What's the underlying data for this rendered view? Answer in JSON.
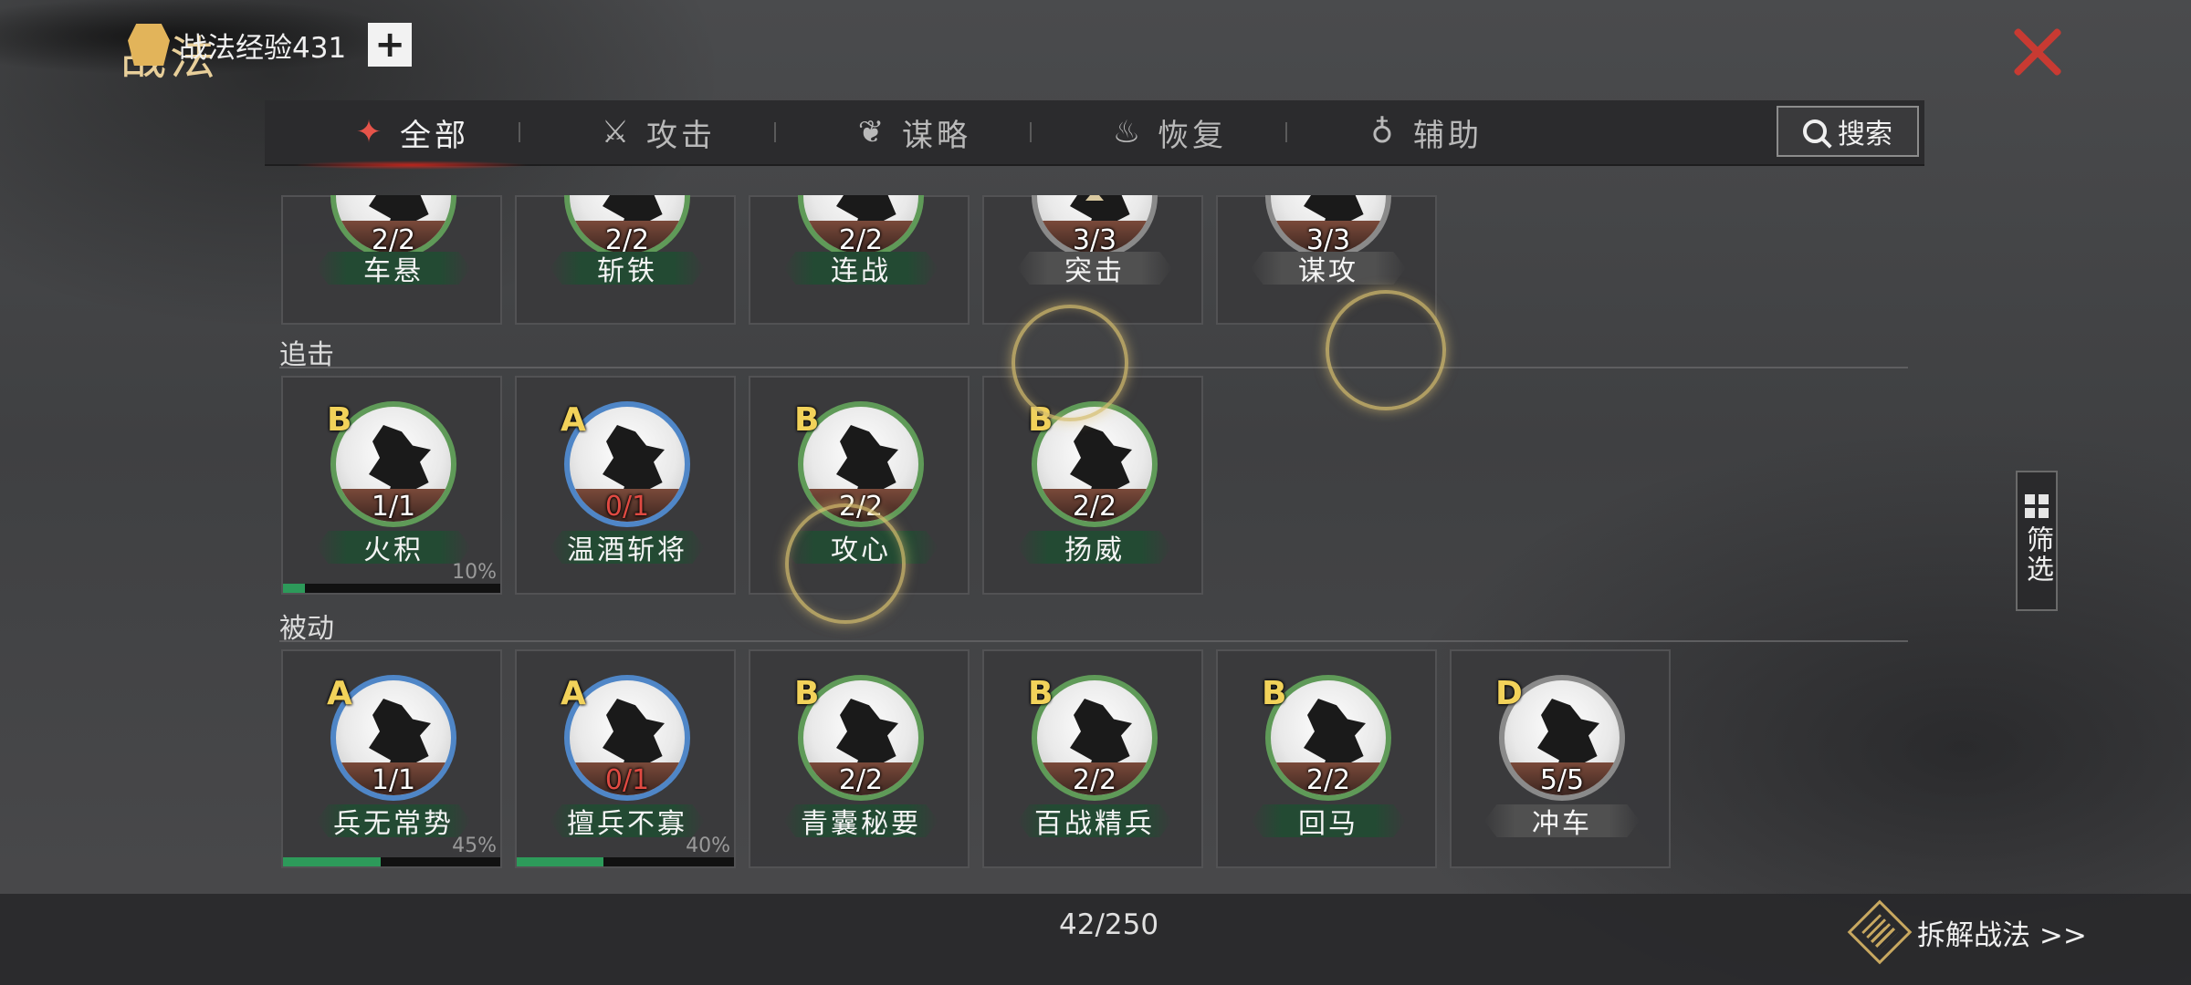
{
  "title": "战法",
  "tabs": [
    {
      "label": "全部",
      "icon": "scroll-icon",
      "active": true
    },
    {
      "label": "攻击",
      "icon": "crossed-swords-icon",
      "active": false
    },
    {
      "label": "谋略",
      "icon": "fan-icon",
      "active": false
    },
    {
      "label": "恢复",
      "icon": "teapot-icon",
      "active": false
    },
    {
      "label": "辅助",
      "icon": "pouch-icon",
      "active": false
    }
  ],
  "search_label": "搜索",
  "filter_label": "筛选",
  "top_row": [
    {
      "name": "车悬",
      "count": "2/2",
      "plate": "green"
    },
    {
      "name": "斩铁",
      "count": "2/2",
      "plate": "green"
    },
    {
      "name": "连战",
      "count": "2/2",
      "plate": "green"
    },
    {
      "name": "突击",
      "count": "3/3",
      "plate": "grey"
    },
    {
      "name": "谋攻",
      "count": "3/3",
      "plate": "grey"
    }
  ],
  "sections": [
    {
      "label": "追击",
      "cards": [
        {
          "grade": "B",
          "name": "火积",
          "count": "1/1",
          "count_red": false,
          "progress": 10,
          "progress_label": "10%"
        },
        {
          "grade": "A",
          "name": "温酒斩将",
          "count": "0/1",
          "count_red": true
        },
        {
          "grade": "B",
          "name": "攻心",
          "count": "2/2",
          "count_red": false
        },
        {
          "grade": "B",
          "name": "扬威",
          "count": "2/2",
          "count_red": false
        }
      ]
    },
    {
      "label": "被动",
      "cards": [
        {
          "grade": "A",
          "name": "兵无常势",
          "count": "1/1",
          "count_red": false,
          "progress": 45,
          "progress_label": "45%"
        },
        {
          "grade": "A",
          "name": "擅兵不寡",
          "count": "0/1",
          "count_red": true,
          "progress": 40,
          "progress_label": "40%"
        },
        {
          "grade": "B",
          "name": "青囊秘要",
          "count": "2/2",
          "count_red": false
        },
        {
          "grade": "B",
          "name": "百战精兵",
          "count": "2/2",
          "count_red": false
        },
        {
          "grade": "B",
          "name": "回马",
          "count": "2/2",
          "count_red": false
        },
        {
          "grade": "D",
          "name": "冲车",
          "count": "5/5",
          "count_red": false
        }
      ]
    }
  ],
  "footer": {
    "exp_label": "战法经验431",
    "plus": "+",
    "capacity": "42/250",
    "dismantle": "拆解战法 >>"
  },
  "colors": {
    "accent_red": "#c83a32",
    "gold": "#e8cf9a",
    "grade_yellow": "#f2d25a",
    "progress_green": "#2d9a5a"
  }
}
